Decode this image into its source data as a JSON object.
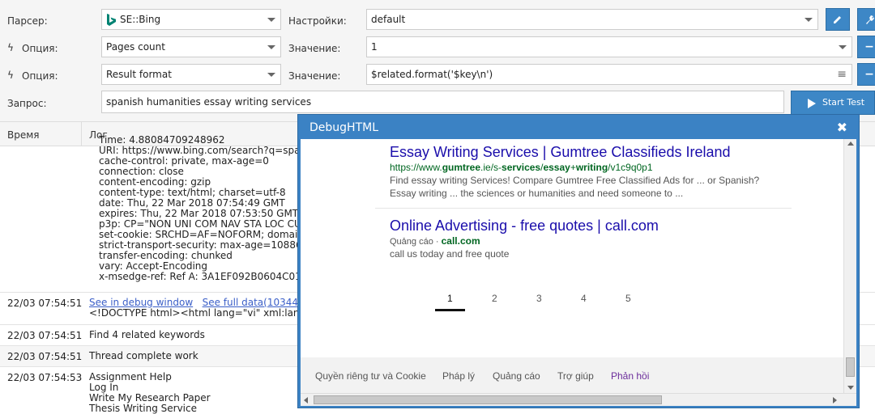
{
  "form": {
    "parser_label": "Парсер:",
    "parser_value": "SE::Bing",
    "settings_label": "Настройки:",
    "settings_value": "default",
    "option_label": "Опция:",
    "option1_value": "Pages count",
    "value_label": "Значение:",
    "value1": "1",
    "option2_value": "Result format",
    "value2": "$related.format('$key\\n')",
    "query_label": "Запрос:",
    "query_value": "spanish humanities essay writing services",
    "start_label": "Start Test"
  },
  "log": {
    "col_time": "Время",
    "col_log": "Лог",
    "header_lines": [
      "Time: 4.88084709248962",
      "URI: https://www.bing.com/search?q=spanis",
      "cache-control: private, max-age=0",
      "connection: close",
      "content-encoding: gzip",
      "content-type: text/html; charset=utf-8",
      "date: Thu, 22 Mar 2018 07:54:49 GMT",
      "expires: Thu, 22 Mar 2018 07:53:50 GMT",
      "p3p: CP=\"NON UNI COM NAV STA LOC CURa",
      "set-cookie: SRCHD=AF=NOFORM; domain=.b",
      "strict-transport-security: max-age=10886400",
      "transfer-encoding: chunked",
      "vary: Accept-Encoding",
      "x-msedge-ref: Ref A: 3A1EF092B0604C01AE2"
    ],
    "rows": [
      {
        "time": "22/03 07:54:51",
        "link1": "See in debug window",
        "link2": "See full data(103444 by",
        "line2": "<!DOCTYPE html><html lang=\"vi\" xml:lang=\"vi\""
      },
      {
        "time": "22/03 07:54:51",
        "message": "Find 4 related keywords"
      },
      {
        "time": "22/03 07:54:51",
        "message": "Thread complete work"
      },
      {
        "time": "22/03 07:54:53",
        "lines": [
          "Assignment Help",
          "Log In",
          "Write My Research Paper",
          "Thesis Writing Service"
        ]
      }
    ]
  },
  "debug": {
    "title": "DebugHTML",
    "results": [
      {
        "title": "Essay Writing Services | Gumtree Classifieds Ireland",
        "url_pre": "https://www.",
        "url_b1": "gumtree",
        "url_mid1": ".ie/s-",
        "url_b2": "services",
        "url_mid2": "/",
        "url_b3": "essay",
        "url_mid3": "+",
        "url_b4": "writing",
        "url_post": "/v1c9q0p1",
        "desc1": "Find essay writing Services! Compare Gumtree Free Classified Ads for ... or Spanish?",
        "desc2": "Essay writing ... the sciences or humanities and need someone to ..."
      },
      {
        "title": "Online Advertising - free quotes | call.com",
        "ad_label": "Quảng cáo · ",
        "url": "call.com",
        "desc1": "call us today and free quote"
      }
    ],
    "pages": [
      "1",
      "2",
      "3",
      "4",
      "5"
    ],
    "footer_links": [
      "Quyền riêng tư và Cookie",
      "Pháp lý",
      "Quảng cáo",
      "Trợ giúp",
      "Phản hồi"
    ]
  },
  "colors": {
    "accent": "#3d87c6",
    "link": "#1a0dab",
    "url": "#006621"
  }
}
